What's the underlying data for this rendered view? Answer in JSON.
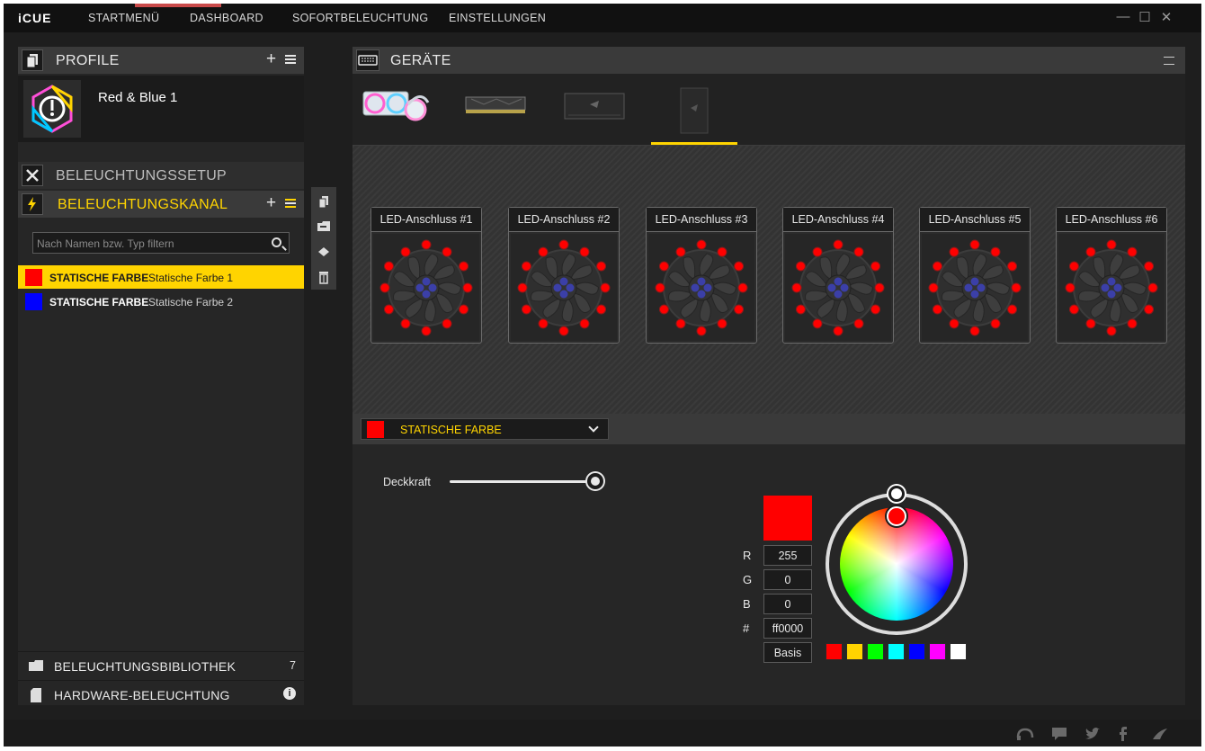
{
  "app": {
    "logo": "iCUE"
  },
  "nav": [
    {
      "label": "STARTMENÜ"
    },
    {
      "label": "DASHBOARD"
    },
    {
      "label": "SOFORTBELEUCHTUNG"
    },
    {
      "label": "EINSTELLUNGEN"
    }
  ],
  "window_controls": {
    "minimize": "—",
    "maximize": "☐",
    "close": "✕"
  },
  "profile": {
    "header": "PROFILE",
    "plus": "+",
    "name": "Red & Blue 1"
  },
  "setup": {
    "header": "BELEUCHTUNGSSETUP"
  },
  "channel": {
    "header": "BELEUCHTUNGSKANAL",
    "plus": "+",
    "search_placeholder": "Nach Namen bzw. Typ filtern",
    "items": [
      {
        "type": "STATISCHE FARBE",
        "name": "Statische Farbe 1",
        "color": "#ff0000",
        "selected": true
      },
      {
        "type": "STATISCHE FARBE",
        "name": "Statische Farbe 2",
        "color": "#0000ff",
        "selected": false
      }
    ]
  },
  "library": {
    "label": "BELEUCHTUNGSBIBLIOTHEK",
    "count": "7"
  },
  "hardware": {
    "label": "HARDWARE-BELEUCHTUNG",
    "info": "i"
  },
  "devices": {
    "header": "GERÄTE",
    "selected_index": 3
  },
  "led_ports": [
    {
      "label": "LED-Anschluss #1"
    },
    {
      "label": "LED-Anschluss #2"
    },
    {
      "label": "LED-Anschluss #3"
    },
    {
      "label": "LED-Anschluss #4"
    },
    {
      "label": "LED-Anschluss #5"
    },
    {
      "label": "LED-Anschluss #6"
    }
  ],
  "effect": {
    "label": "STATISCHE FARBE",
    "color": "#ff0000"
  },
  "editor": {
    "opacity_label": "Deckkraft",
    "opacity_value": 1.0,
    "r_label": "R",
    "r": "255",
    "g_label": "G",
    "g": "0",
    "b_label": "B",
    "b": "0",
    "hex_label": "#",
    "hex": "ff0000",
    "basis": "Basis",
    "presets": [
      "#ff0000",
      "#ffd400",
      "#00ff00",
      "#00ffff",
      "#0000ff",
      "#ff00ff",
      "#ffffff"
    ]
  },
  "colors": {
    "accent": "#ffd400",
    "led": "#ff0000"
  }
}
